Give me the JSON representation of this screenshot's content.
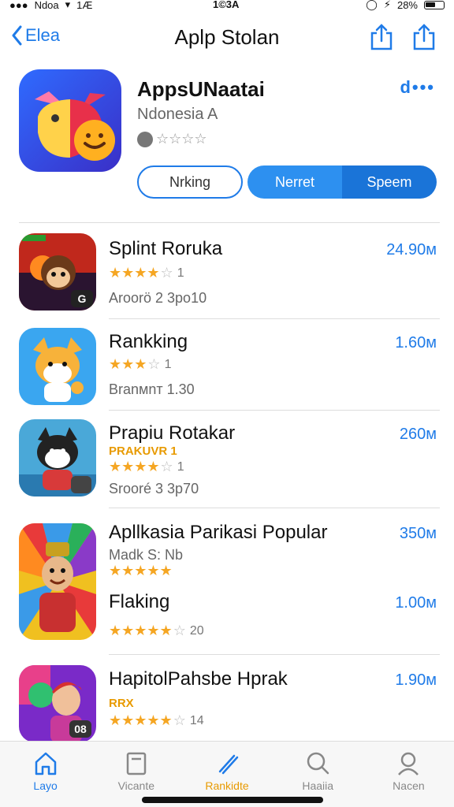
{
  "status_bar": {
    "carrier": "Ndoa",
    "network": "1Æ",
    "time": "1©3A",
    "battery": "28%"
  },
  "nav": {
    "back_label": "Elea",
    "title": "Aplp Stolan"
  },
  "featured": {
    "title": "AppsUNaatai",
    "subtitle": "Ndonesia A",
    "rating_stars": "☆☆☆☆",
    "more_label": "d•••",
    "segments": {
      "outline": "Nrking",
      "filled_a": "Nerret",
      "filled_b": "Speem"
    }
  },
  "apps": [
    {
      "title": "Splint Roruka",
      "size": "24.90м",
      "stars": "★★★★",
      "star_count": 4,
      "star_extra": "☆",
      "rating": "1",
      "tag": "",
      "sub": "Aroorö 2 3po10",
      "badge": "G"
    },
    {
      "title": "Rankking",
      "size": "1.60м",
      "stars": "★★★",
      "star_count": 3,
      "star_extra": "☆",
      "rating": "1",
      "tag": "",
      "sub": "Branмnт 1.30",
      "badge": ""
    },
    {
      "title": "Prapiu Rotakar",
      "size": "260м",
      "stars": "★★★★",
      "star_count": 4,
      "star_extra": "☆",
      "rating": "1",
      "tag": "PRAKUVR 1",
      "sub": "Srooré 3 3p70",
      "badge": ""
    },
    {
      "title": "Apllkasia Parikasi Popular",
      "size": "350м",
      "stars": "★★★★★",
      "star_count": 5,
      "star_extra": "",
      "rating": "",
      "tag": "",
      "sub": "Madk S: Nb",
      "badge": ""
    },
    {
      "title": "Flaking",
      "size": "1.00м",
      "stars": "★★★★★",
      "star_count": 5,
      "star_extra": "☆",
      "rating": "20",
      "tag": "",
      "sub": "",
      "badge": ""
    },
    {
      "title": "HapitolPahsbe Hprak",
      "size": "1.90м",
      "stars": "★★★★★",
      "star_count": 5,
      "star_extra": "☆",
      "rating": "14",
      "tag": "RRX",
      "sub": "",
      "badge": "08"
    }
  ],
  "tabs": [
    {
      "label": "Layo",
      "icon": "home-icon"
    },
    {
      "label": "Vicante",
      "icon": "document-icon"
    },
    {
      "label": "Rankidte",
      "icon": "pencil-icon"
    },
    {
      "label": "Haaiia",
      "icon": "search-icon"
    },
    {
      "label": "Nacen",
      "icon": "person-icon"
    }
  ],
  "colors": {
    "accent": "#1f7be8",
    "star": "#f5a623",
    "tag": "#e89a00"
  }
}
